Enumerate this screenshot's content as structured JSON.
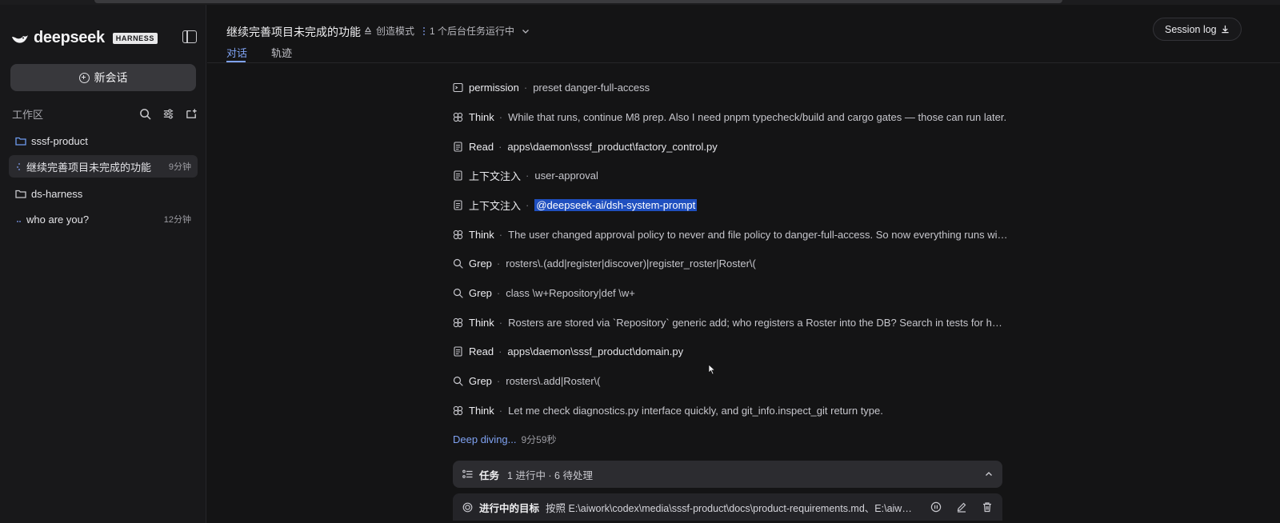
{
  "brand": {
    "name": "deepseek",
    "badge": "HARNESS"
  },
  "sidebar": {
    "new_chat_label": "新会话",
    "workspace_label": "工作区",
    "items": [
      {
        "type": "folder",
        "label": "sssf-product"
      },
      {
        "type": "session",
        "label": "继续完善项目未完成的功能",
        "time": "9分钟",
        "active": true
      },
      {
        "type": "folder",
        "label": "ds-harness"
      },
      {
        "type": "session",
        "label": "who are you?",
        "time": "12分钟"
      }
    ]
  },
  "header": {
    "title": "继续完善项目未完成的功能",
    "mode": "创造模式",
    "background_tasks": "1 个后台任务运行中",
    "tabs": [
      "对话",
      "轨迹"
    ],
    "session_log": "Session log"
  },
  "feed": [
    {
      "icon": "terminal-icon",
      "kind": "permission",
      "text": "preset danger-full-access"
    },
    {
      "icon": "think-icon",
      "kind": "Think",
      "text": "While that runs, continue M8 prep. Also I need pnpm typecheck/build and cargo gates — those can run later."
    },
    {
      "icon": "document-icon",
      "kind": "Read",
      "text": "apps\\daemon\\sssf_product\\factory_control.py",
      "link": true
    },
    {
      "icon": "document-icon",
      "kind": "上下文注入",
      "text": "user-approval"
    },
    {
      "icon": "document-icon",
      "kind": "上下文注入",
      "text": "@deepseek-ai/dsh-system-prompt",
      "highlight": true
    },
    {
      "icon": "think-icon",
      "kind": "Think",
      "text": "The user changed approval policy to never and file policy to danger-full-access. So now everything runs wit..."
    },
    {
      "icon": "search-icon",
      "kind": "Grep",
      "text": "rosters\\.(add|register|discover)|register_roster|Roster\\("
    },
    {
      "icon": "search-icon",
      "kind": "Grep",
      "text": "class \\w+Repository|def \\w+"
    },
    {
      "icon": "think-icon",
      "kind": "Think",
      "text": "Rosters are stored via `Repository` generic add; who registers a Roster into the DB? Search in tests for how r..."
    },
    {
      "icon": "document-icon",
      "kind": "Read",
      "text": "apps\\daemon\\sssf_product\\domain.py",
      "link": true
    },
    {
      "icon": "search-icon",
      "kind": "Grep",
      "text": "rosters\\.add|Roster\\("
    },
    {
      "icon": "think-icon",
      "kind": "Think",
      "text": "Let me check diagnostics.py interface quickly, and git_info.inspect_git return type."
    }
  ],
  "status": {
    "label": "Deep diving...",
    "elapsed": "9分59秒"
  },
  "tasks": {
    "label": "任务",
    "meta": "1 进行中 · 6 待处理"
  },
  "goal": {
    "label": "进行中的目标",
    "text": "按照 E:\\aiwork\\codex\\media\\sssf-product\\docs\\product-requirements.md、E:\\aiwork\\..."
  }
}
